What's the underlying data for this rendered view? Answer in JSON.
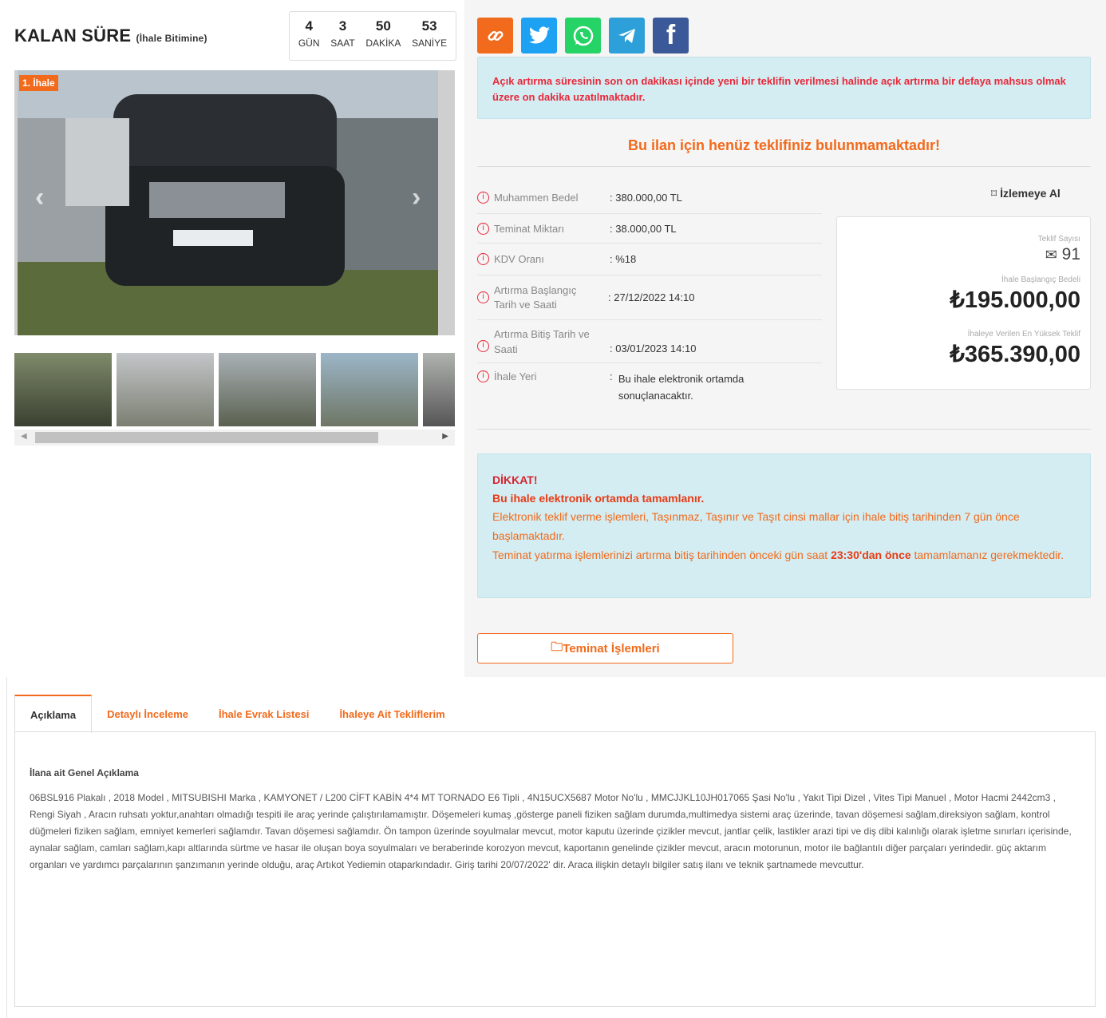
{
  "countdown": {
    "title": "KALAN SÜRE",
    "subtitle": "(İhale Bitimine)",
    "units": [
      {
        "value": "4",
        "label": "GÜN"
      },
      {
        "value": "3",
        "label": "SAAT"
      },
      {
        "value": "50",
        "label": "DAKİKA"
      },
      {
        "value": "53",
        "label": "SANİYE"
      }
    ]
  },
  "gallery": {
    "badge": "1. İhale",
    "plate": "06 BSL 916"
  },
  "share": {
    "icons": [
      "link-icon",
      "twitter-icon",
      "whatsapp-icon",
      "telegram-icon",
      "facebook-icon"
    ]
  },
  "notice": "Açık artırma süresinin son on dakikası içinde yeni bir teklifin verilmesi halinde açık artırma bir defaya mahsus olmak üzere on dakika uzatılmaktadır.",
  "no_bid": "Bu ilan için henüz teklifiniz bulunmamaktadır!",
  "details": [
    {
      "label": "Muhammen Bedel",
      "value": "380.000,00 TL"
    },
    {
      "label": "Teminat Miktarı",
      "value": "38.000,00 TL"
    },
    {
      "label": "KDV Oranı",
      "value": "%18"
    },
    {
      "label": "Artırma Başlangıç Tarih ve Saati",
      "value": "27/12/2022 14:10"
    },
    {
      "label": "Artırma Bitiş Tarih ve Saati",
      "value": "03/01/2023 14:10"
    },
    {
      "label": "İhale Yeri",
      "value": "Bu ihale elektronik ortamda sonuçlanacaktır."
    }
  ],
  "watch_label": "İzlemeye Al",
  "stats": {
    "bid_count_label": "Teklif Sayısı",
    "bid_count": "91",
    "start_label": "İhale Başlangıç Bedeli",
    "start_value": "₺195.000,00",
    "top_label": "İhaleye Verilen En Yüksek Teklif",
    "top_value": "₺365.390,00"
  },
  "warning": {
    "title": "DİKKAT!",
    "bold": "Bu ihale elektronik ortamda tamamlanır.",
    "line1": "Elektronik teklif verme işlemleri, Taşınmaz, Taşınır ve Taşıt cinsi mallar için ihale bitiş tarihinden 7 gün önce başlamaktadır.",
    "line2a": "Teminat yatırma işlemlerinizi artırma bitiş tarihinden önceki gün saat ",
    "line2b": "23:30'dan önce",
    "line2c": " tamamlamanız gerekmektedir."
  },
  "teminat_button": "Teminat İşlemleri",
  "tabs": [
    "Açıklama",
    "Detaylı İnceleme",
    "İhale Evrak Listesi",
    "İhaleye Ait Tekliflerim"
  ],
  "description": {
    "heading": "İlana ait Genel Açıklama",
    "text": "06BSL916 Plakalı , 2018 Model , MITSUBISHI Marka , KAMYONET / L200 CİFT KABİN 4*4 MT TORNADO E6 Tipli , 4N15UCX5687 Motor No'lu , MMCJJKL10JH017065 Şasi No'lu , Yakıt Tipi Dizel , Vites Tipi Manuel , Motor Hacmi 2442cm3 , Rengi Siyah , Aracın ruhsatı yoktur,anahtarı olmadığı tespiti ile araç yerinde çalıştırılamamıştır. Döşemeleri kumaş ,gösterge paneli fiziken sağlam durumda,multimedya sistemi araç üzerinde, tavan döşemesi sağlam,direksiyon sağlam, kontrol düğmeleri fiziken sağlam, emniyet kemerleri sağlamdır. Tavan döşemesi sağlamdır. Ön tampon üzerinde soyulmalar mevcut, motor kaputu üzerinde çizikler mevcut, jantlar çelik, lastikler arazi tipi ve diş dibi kalınlığı olarak işletme sınırları içerisinde, aynalar sağlam, camları sağlam,kapı altlarında sürtme ve hasar ile oluşan boya soyulmaları ve beraberinde korozyon mevcut, kaportanın genelinde çizikler mevcut, aracın motorunun, motor ile bağlantılı diğer parçaları yerindedir. güç aktarım organları ve yardımcı parçalarının şanzımanın yerinde olduğu, araç Artıkot Yediemin otaparkındadır. Giriş tarihi 20/07/2022' dir. Araca ilişkin detaylı bilgiler satış ilanı ve teknik şartnamede mevcuttur."
  }
}
